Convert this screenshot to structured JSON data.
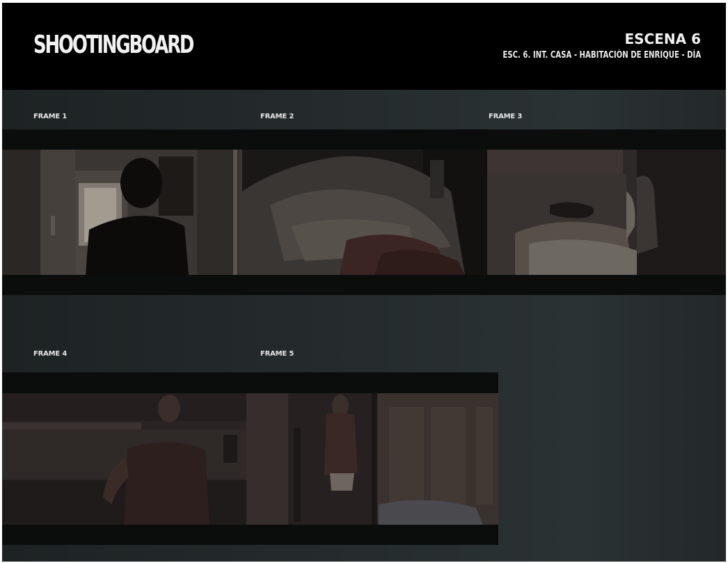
{
  "header": {
    "brand": "SHOOTINGBOARD",
    "scene_title": "ESCENA 6",
    "scene_subtitle": "ESC. 6. INT. CASA - HABITACIÓN DE ENRIQUE - DÍA"
  },
  "frames": [
    {
      "label": "FRAME 1"
    },
    {
      "label": "FRAME 2"
    },
    {
      "label": "FRAME 3"
    },
    {
      "label": "FRAME 4"
    },
    {
      "label": "FRAME 5"
    }
  ],
  "colors": {
    "header_background": "#000000",
    "board_background": "#252b2c",
    "film_strip": "#0b0d0d",
    "label_text": "#e6e6e6"
  }
}
